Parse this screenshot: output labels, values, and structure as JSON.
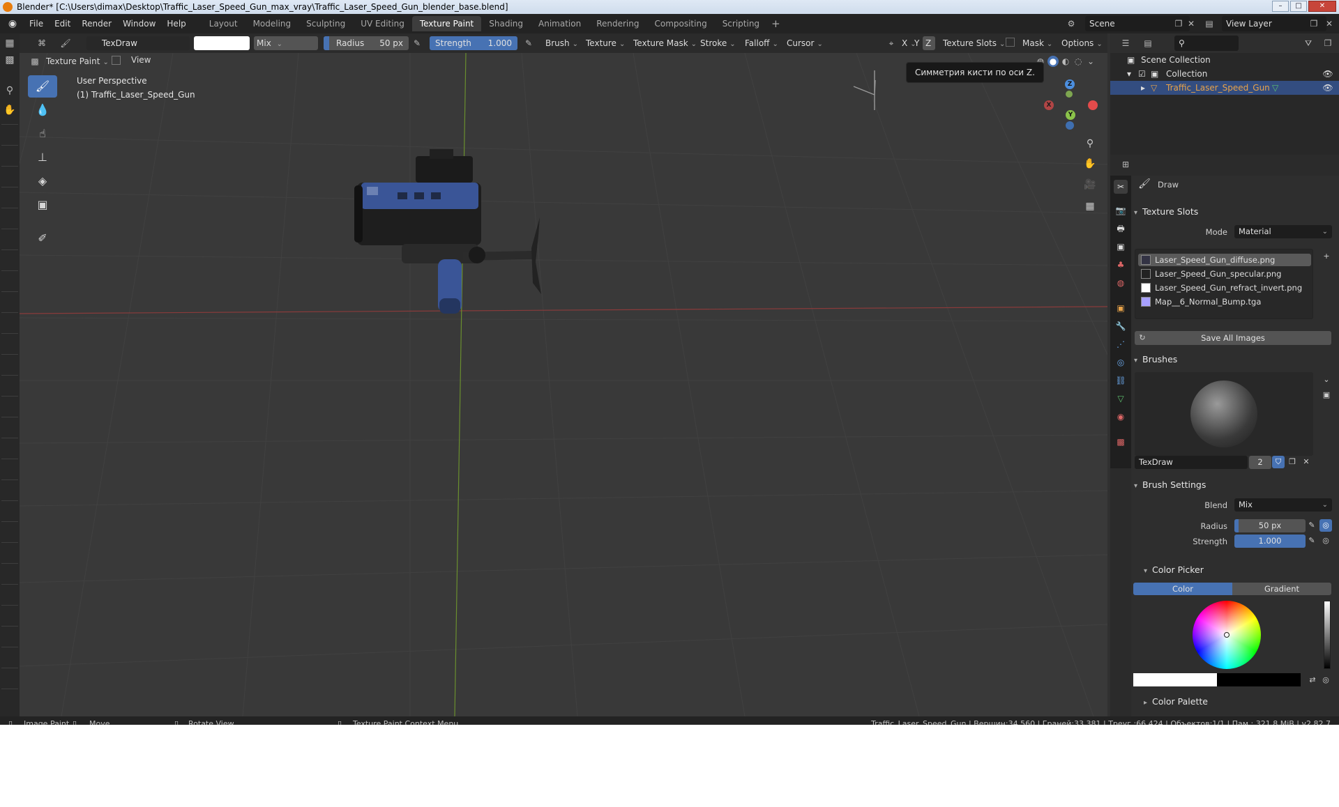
{
  "window": {
    "title": "Blender* [C:\\Users\\dimax\\Desktop\\Traffic_Laser_Speed_Gun_max_vray\\Traffic_Laser_Speed_Gun_blender_base.blend]"
  },
  "menu": {
    "items": [
      "File",
      "Edit",
      "Render",
      "Window",
      "Help"
    ]
  },
  "workspaces": {
    "tabs": [
      "Layout",
      "Modeling",
      "Sculpting",
      "UV Editing",
      "Texture Paint",
      "Shading",
      "Animation",
      "Rendering",
      "Compositing",
      "Scripting"
    ],
    "active": "Texture Paint",
    "add": "+"
  },
  "topright": {
    "scene": "Scene",
    "view_layer": "View Layer"
  },
  "toolheader": {
    "brush_name": "TexDraw",
    "blend": "Mix",
    "radius_label": "Radius",
    "radius_value": "50 px",
    "strength_label": "Strength",
    "strength_value": "1.000",
    "menus": [
      "Brush",
      "Texture",
      "Texture Mask",
      "Stroke",
      "Falloff",
      "Cursor"
    ],
    "axes": [
      "X",
      "Y",
      "Z"
    ],
    "texture_slots": "Texture Slots",
    "mask": "Mask",
    "options": "Options"
  },
  "viewport": {
    "mode": "Texture Paint",
    "view_menu": "View",
    "perspective": "User Perspective",
    "object_line": "(1) Traffic_Laser_Speed_Gun",
    "tooltip": "Симметрия кисти по оси Z.",
    "gizmo": {
      "x": "X",
      "y": "Y",
      "z": "Z"
    }
  },
  "outliner": {
    "scene_collection": "Scene Collection",
    "collection": "Collection",
    "object": "Traffic_Laser_Speed_Gun"
  },
  "properties": {
    "tool_name": "Draw",
    "texture_slots": {
      "header": "Texture Slots",
      "mode_label": "Mode",
      "mode_value": "Material",
      "slots": [
        "Laser_Speed_Gun_diffuse.png",
        "Laser_Speed_Gun_specular.png",
        "Laser_Speed_Gun_refract_invert.png",
        "Map__6_Normal_Bump.tga"
      ],
      "save_all": "Save All Images"
    },
    "brushes": {
      "header": "Brushes",
      "name": "TexDraw",
      "users": "2"
    },
    "brush_settings": {
      "header": "Brush Settings",
      "blend_label": "Blend",
      "blend_value": "Mix",
      "radius_label": "Radius",
      "radius_value": "50 px",
      "strength_label": "Strength",
      "strength_value": "1.000"
    },
    "color_picker": {
      "header": "Color Picker",
      "tab_color": "Color",
      "tab_gradient": "Gradient"
    },
    "color_palette": {
      "header": "Color Palette"
    }
  },
  "statusbar": {
    "image_paint": "Image Paint",
    "move": "Move",
    "rotate": "Rotate View",
    "context_menu": "Texture Paint Context Menu",
    "stats": "Traffic_Laser_Speed_Gun | Вершин:34,560 | Граней:33,381 | Треуг.:66,424 | Объектов:1/1 | Пам.: 321.8 MiB | v2.82.7"
  },
  "colors": {
    "accent": "#4772b3",
    "axis_x": "#e44b4b",
    "axis_y": "#8bc34a",
    "axis_z": "#4c8fe0",
    "model_blue": "#3a5597"
  }
}
